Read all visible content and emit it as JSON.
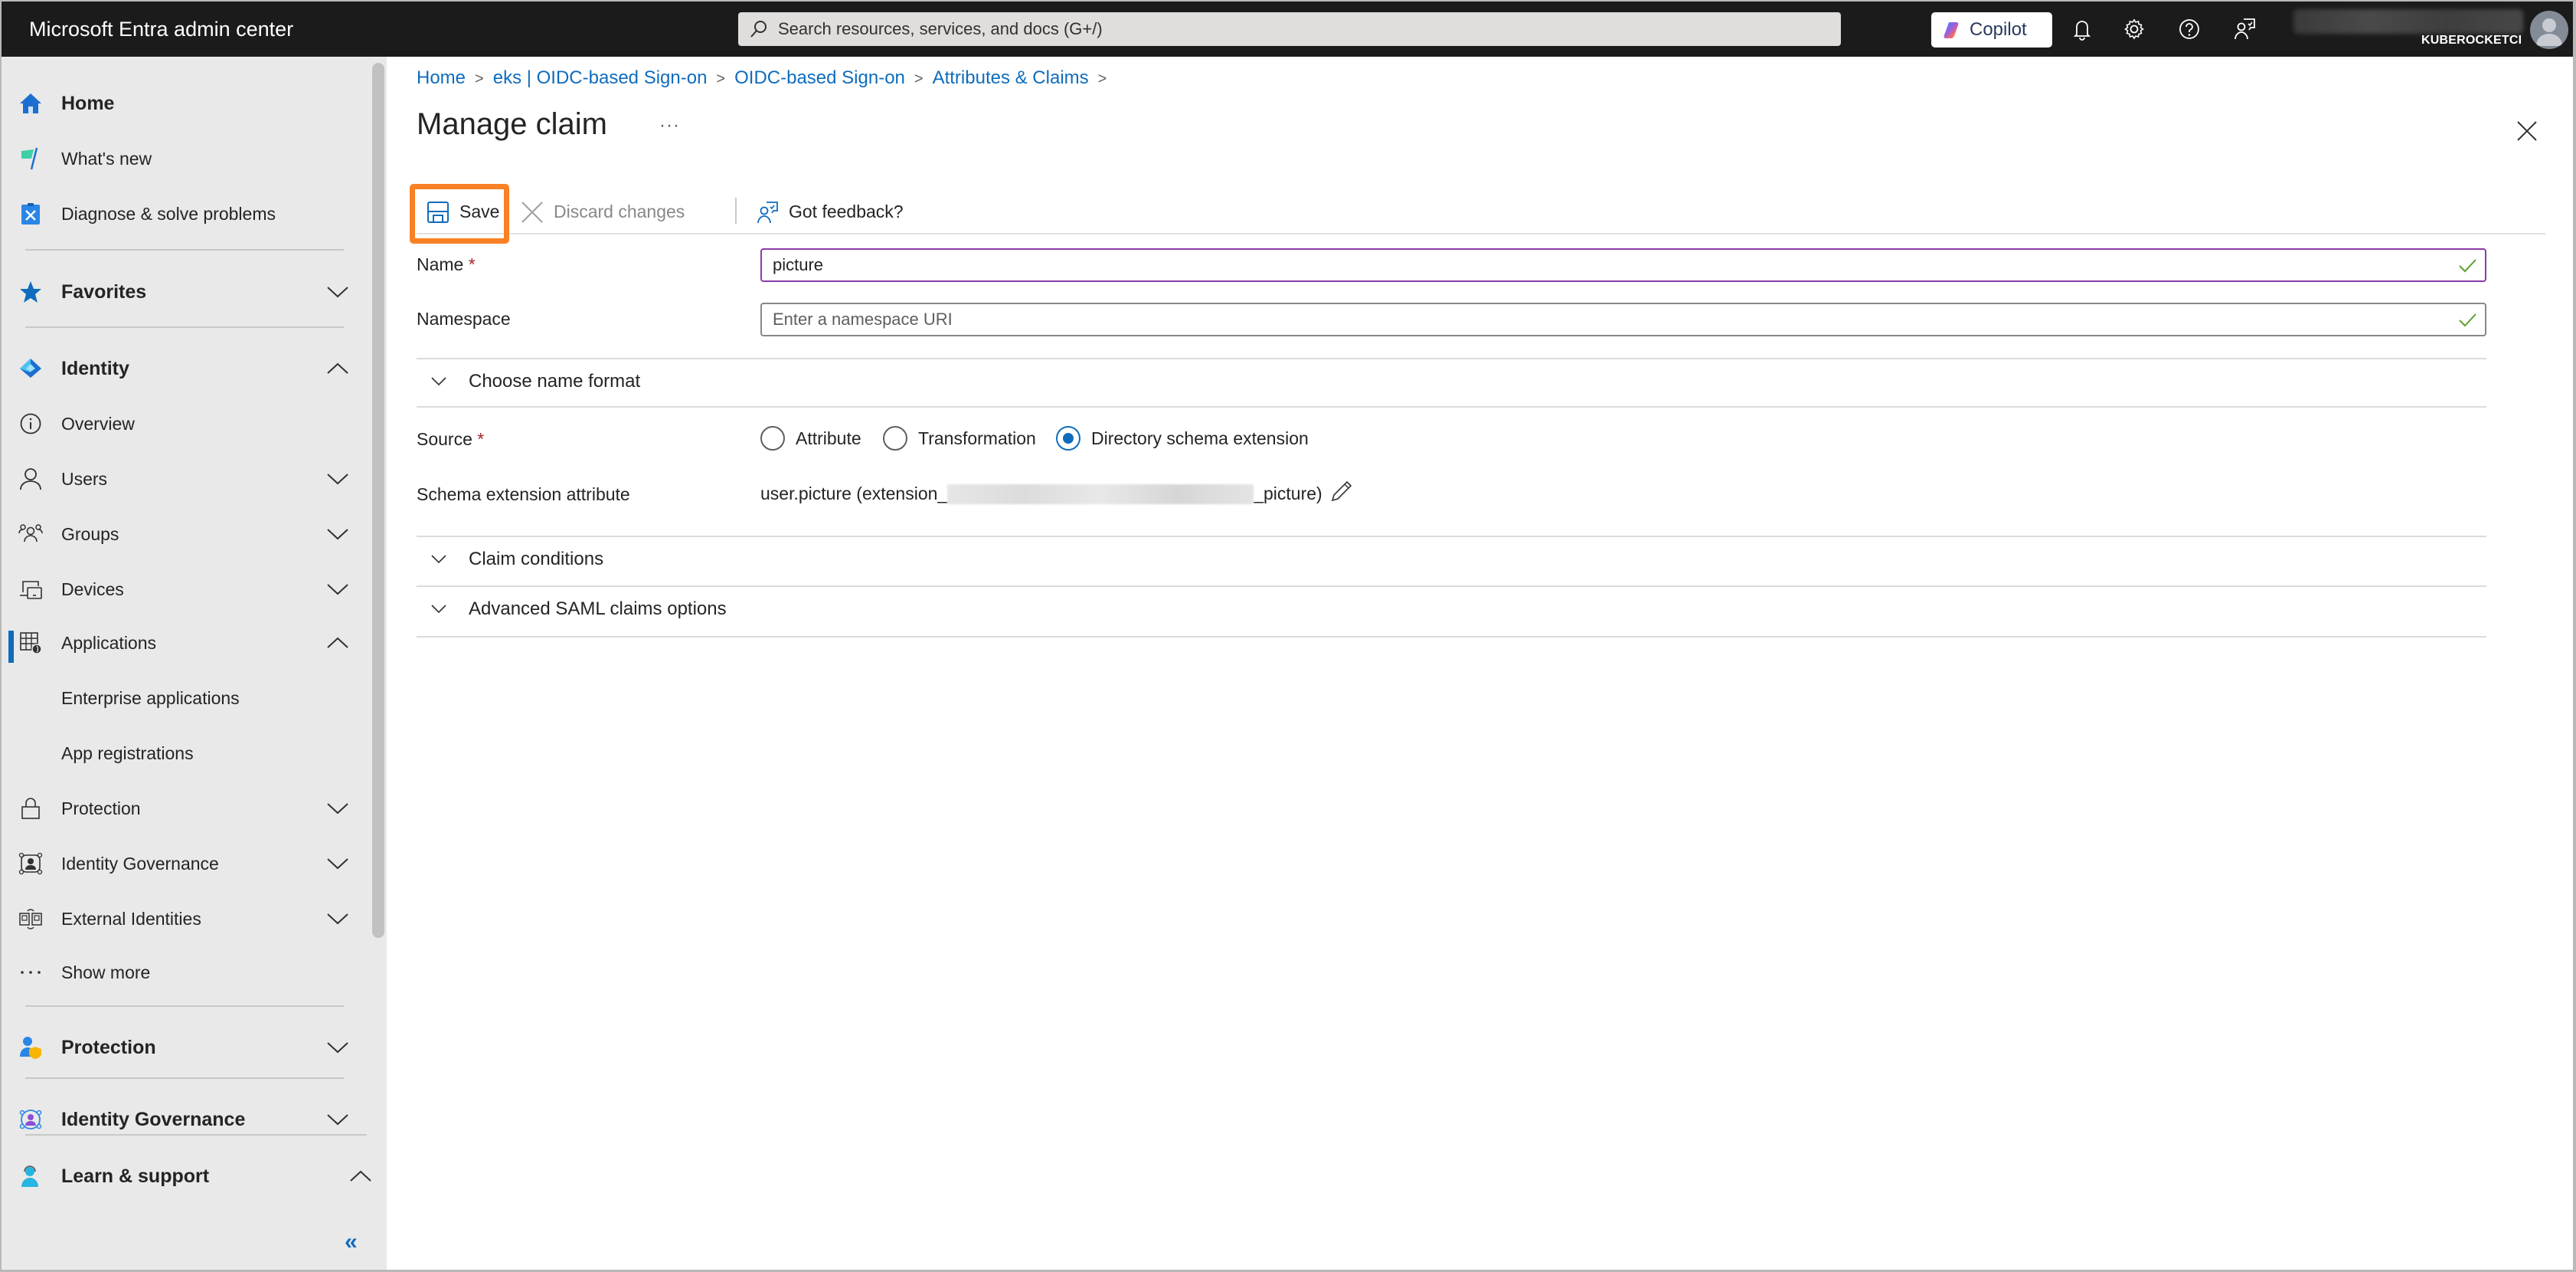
{
  "topbar": {
    "brand": "Microsoft Entra admin center",
    "search_placeholder": "Search resources, services, and docs (G+/)",
    "copilot_label": "Copilot",
    "icons": [
      "bell-icon",
      "gear-icon",
      "help-icon",
      "feedback-icon"
    ],
    "account_org": "KUBEROCKETCI"
  },
  "sidebar": {
    "items": [
      {
        "label": "Home",
        "icon": "home-icon",
        "bold": true
      },
      {
        "label": "What's new",
        "icon": "flag-icon"
      },
      {
        "label": "Diagnose & solve problems",
        "icon": "diagnose-icon"
      },
      {
        "label": "Favorites",
        "icon": "star-icon",
        "bold": true,
        "chevron": "down"
      },
      {
        "label": "Identity",
        "icon": "identity-icon",
        "bold": true,
        "chevron": "up"
      },
      {
        "label": "Overview",
        "icon": "info-icon"
      },
      {
        "label": "Users",
        "icon": "user-icon",
        "chevron": "down"
      },
      {
        "label": "Groups",
        "icon": "groups-icon",
        "chevron": "down"
      },
      {
        "label": "Devices",
        "icon": "devices-icon",
        "chevron": "down"
      },
      {
        "label": "Applications",
        "icon": "applications-icon",
        "chevron": "up",
        "selected": true
      },
      {
        "label": "Enterprise applications"
      },
      {
        "label": "App registrations"
      },
      {
        "label": "Protection",
        "icon": "lock-icon",
        "chevron": "down"
      },
      {
        "label": "Identity Governance",
        "icon": "governance-icon",
        "chevron": "down"
      },
      {
        "label": "External Identities",
        "icon": "external-identities-icon",
        "chevron": "down"
      },
      {
        "label": "Show more",
        "icon": "more-icon"
      },
      {
        "label": "Protection",
        "icon": "protection-icon",
        "bold": true,
        "chevron": "down"
      },
      {
        "label": "Identity Governance",
        "icon": "identity-governance-icon",
        "bold": true,
        "chevron": "down"
      },
      {
        "label": "Learn & support",
        "icon": "support-icon",
        "bold": true,
        "chevron": "up"
      }
    ],
    "collapse_label": "«"
  },
  "breadcrumb": [
    "Home",
    "eks | OIDC-based Sign-on",
    "OIDC-based Sign-on",
    "Attributes & Claims"
  ],
  "page": {
    "title": "Manage claim",
    "more": "···"
  },
  "toolbar": {
    "save_label": "Save",
    "discard_label": "Discard changes",
    "feedback_label": "Got feedback?"
  },
  "form": {
    "name_label": "Name",
    "name_value": "picture",
    "namespace_label": "Namespace",
    "namespace_placeholder": "Enter a namespace URI",
    "name_format_label": "Choose name format",
    "source_label": "Source",
    "required_mark": "*",
    "source_options": [
      "Attribute",
      "Transformation",
      "Directory schema extension"
    ],
    "source_selected": "Directory schema extension",
    "schema_label": "Schema extension attribute",
    "schema_prefix": "user.picture (extension_",
    "schema_suffix": "_picture)",
    "claim_conditions_label": "Claim conditions",
    "advanced_label": "Advanced SAML claims options"
  },
  "colors": {
    "accent": "#0f6cbd",
    "highlight": "#f98024",
    "focus_border": "#8a3ba6",
    "valid_check": "#5ca02c",
    "required": "#a4262c"
  }
}
